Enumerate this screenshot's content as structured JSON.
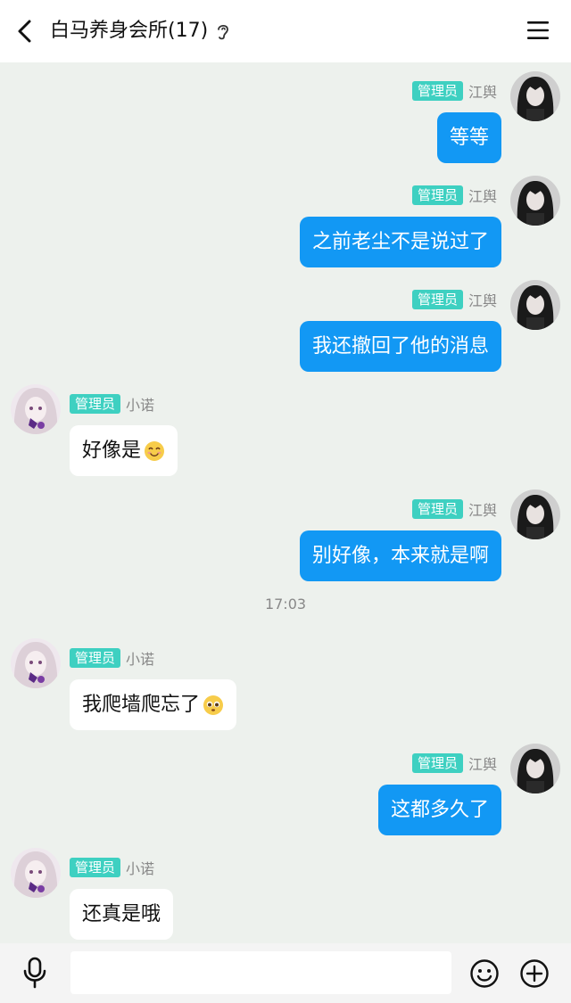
{
  "header": {
    "back_icon": "chevron-left-icon",
    "title": "白马养身会所(17)",
    "ear_icon": "ear-icon",
    "menu_icon": "menu-icon"
  },
  "chat": {
    "messages": [
      {
        "side": "right",
        "badge": "管理员",
        "sender": "江舆",
        "text": "等等"
      },
      {
        "side": "right",
        "badge": "管理员",
        "sender": "江舆",
        "text": "之前老尘不是说过了"
      },
      {
        "side": "right",
        "badge": "管理员",
        "sender": "江舆",
        "text": "我还撤回了他的消息"
      },
      {
        "side": "left",
        "badge": "管理员",
        "sender": "小诺",
        "text": "好像是",
        "emoji": "smiling-face-emoji"
      },
      {
        "side": "right",
        "badge": "管理员",
        "sender": "江舆",
        "text": "别好像，本来就是啊"
      },
      {
        "side": "left",
        "badge": "管理员",
        "sender": "小诺",
        "text": "我爬墙爬忘了",
        "emoji": "pleading-face-emoji"
      },
      {
        "side": "right",
        "badge": "管理员",
        "sender": "江舆",
        "text": "这都多久了"
      },
      {
        "side": "left",
        "badge": "管理员",
        "sender": "小诺",
        "text": "还真是哦"
      }
    ],
    "timestamp": "17:03"
  },
  "footer": {
    "mic_icon": "microphone-icon",
    "input_value": "",
    "emoji_icon": "smiley-icon",
    "plus_icon": "plus-circle-icon"
  },
  "colors": {
    "background": "#edf1ed",
    "outgoing_bubble": "#1298f4",
    "incoming_bubble": "#ffffff",
    "badge": "#3ed0c1"
  }
}
